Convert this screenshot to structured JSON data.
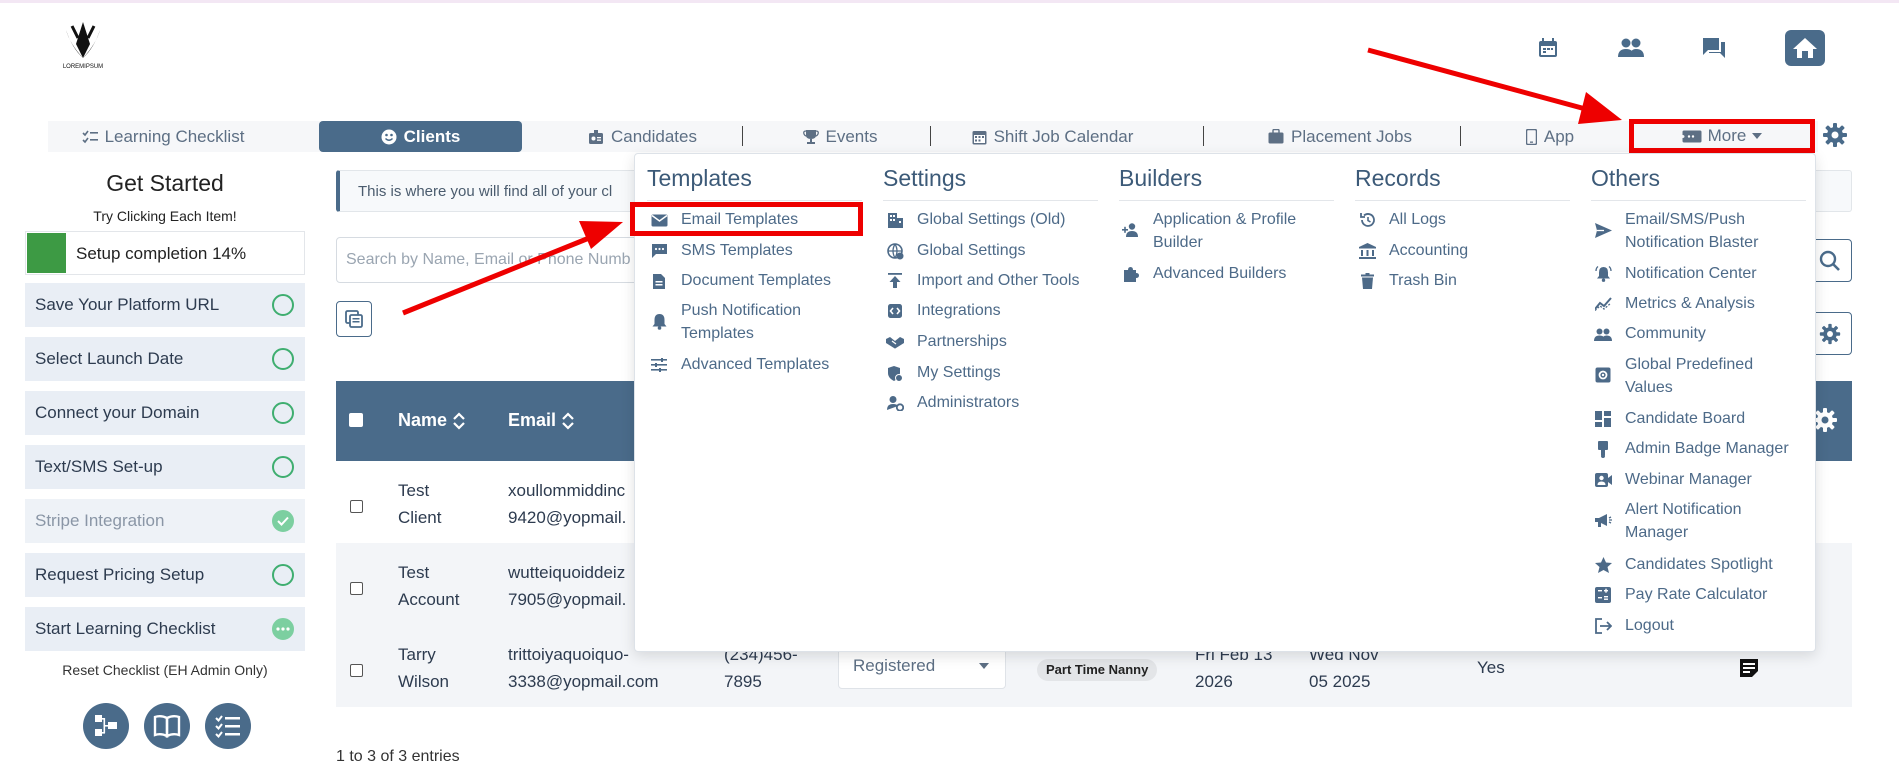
{
  "header": {
    "logo_text": "LOREMIPSUM"
  },
  "nav": {
    "items": [
      {
        "label": "Learning Checklist"
      },
      {
        "label": "Clients"
      },
      {
        "label": "Candidates"
      },
      {
        "label": "Events"
      },
      {
        "label": "Shift Job Calendar"
      },
      {
        "label": "Placement Jobs"
      },
      {
        "label": "App"
      },
      {
        "label": "More"
      }
    ]
  },
  "sidebar": {
    "title": "Get Started",
    "subtitle": "Try Clicking Each Item!",
    "progress_label": "Setup completion 14%",
    "progress_fraction": 0.14,
    "items": [
      {
        "label": "Save Your Platform URL",
        "status": "open"
      },
      {
        "label": "Select Launch Date",
        "status": "open"
      },
      {
        "label": "Connect your Domain",
        "status": "open"
      },
      {
        "label": "Text/SMS Set-up",
        "status": "open"
      },
      {
        "label": "Stripe Integration",
        "status": "done"
      },
      {
        "label": "Request Pricing Setup",
        "status": "open"
      },
      {
        "label": "Start Learning Checklist",
        "status": "in-progress"
      }
    ],
    "reset_label": "Reset Checklist (EH Admin Only)"
  },
  "main": {
    "info_text": "This is where you will find all of your cl",
    "search_placeholder": "Search by Name, Email or Phone Numb",
    "table": {
      "headers": {
        "name": "Name",
        "email": "Email"
      },
      "rows": [
        {
          "name": "Test Client",
          "email": "xoullommiddinc 9420@yopmail."
        },
        {
          "name": "Test Account",
          "email": "wutteiquoiddeiz 7905@yopmail."
        },
        {
          "name": "Tarry Wilson",
          "email": "trittoiyaquoiquo- 3338@yopmail.com",
          "phone": "(234)456- 7895",
          "status": "Registered",
          "tag": "Part Time Nanny",
          "date1": "Fri Feb 13 2026",
          "date2": "Wed Nov 05 2025",
          "flag": "Yes"
        }
      ]
    },
    "entries_text": "1 to 3 of 3 entries"
  },
  "dropdown": {
    "columns": [
      {
        "title": "Templates",
        "items": [
          "Email Templates",
          "SMS Templates",
          "Document Templates",
          "Push Notification Templates",
          "Advanced Templates"
        ]
      },
      {
        "title": "Settings",
        "items": [
          "Global Settings (Old)",
          "Global Settings",
          "Import and Other Tools",
          "Integrations",
          "Partnerships",
          "My Settings",
          "Administrators"
        ]
      },
      {
        "title": "Builders",
        "items": [
          "Application & Profile Builder",
          "Advanced Builders"
        ]
      },
      {
        "title": "Records",
        "items": [
          "All Logs",
          "Accounting",
          "Trash Bin"
        ]
      },
      {
        "title": "Others",
        "items": [
          "Email/SMS/Push Notification Blaster",
          "Notification Center",
          "Metrics & Analysis",
          "Community",
          "Global Predefined Values",
          "Candidate Board",
          "Admin Badge Manager",
          "Webinar Manager",
          "Alert Notification Manager",
          "Candidates Spotlight",
          "Pay Rate Calculator",
          "Logout"
        ]
      }
    ]
  },
  "colors": {
    "primary": "#4a6b8a",
    "annotation": "#ee0000",
    "success": "#3d9a44"
  }
}
